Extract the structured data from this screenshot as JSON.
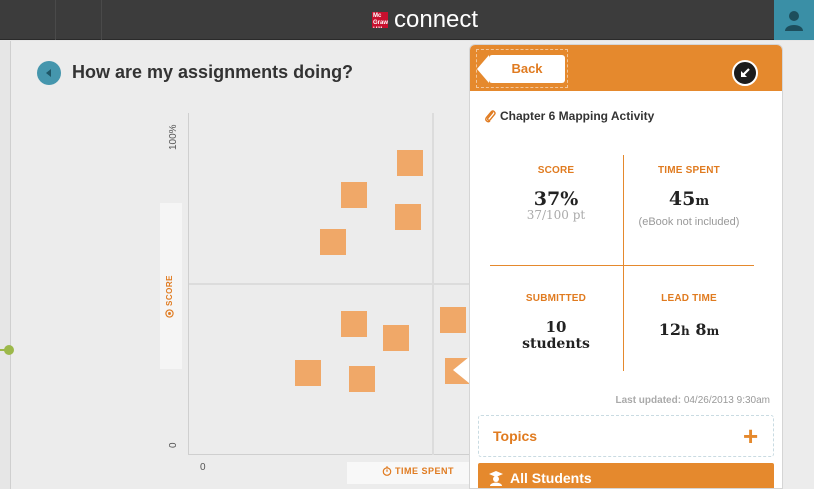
{
  "header": {
    "brand_logo_text": "Mc Graw Hill",
    "brand_name": "connect",
    "user_icon": "user-icon"
  },
  "page": {
    "title": "How are my assignments doing?"
  },
  "chart_data": {
    "type": "scatter",
    "xlabel": "TIME SPENT",
    "ylabel": "SCORE",
    "y_ticks": [
      "100%",
      "0"
    ],
    "x_ticks": [
      "0"
    ],
    "points_count_visible": 10
  },
  "panel": {
    "back_label": "Back",
    "activity_title": "Chapter 6 Mapping Activity",
    "score": {
      "label": "SCORE",
      "value": "37%",
      "sub": "37/100 pt"
    },
    "time_spent": {
      "label": "TIME SPENT",
      "value_num": "45",
      "value_unit": "m",
      "sub": "(eBook not included)"
    },
    "submitted": {
      "label": "SUBMITTED",
      "value": "10",
      "sub": "students"
    },
    "lead_time": {
      "label": "LEAD TIME",
      "h_num": "12",
      "h_unit": "h",
      "m_num": "8",
      "m_unit": "m"
    },
    "last_updated_label": "Last updated:",
    "last_updated_value": "04/26/2013 9:30am",
    "topics_label": "Topics",
    "all_students_label": "All Students"
  },
  "colors": {
    "accent": "#e5892d",
    "point": "#f0a868",
    "topbar": "#3c3c3c",
    "back_circle": "#4596ad"
  }
}
